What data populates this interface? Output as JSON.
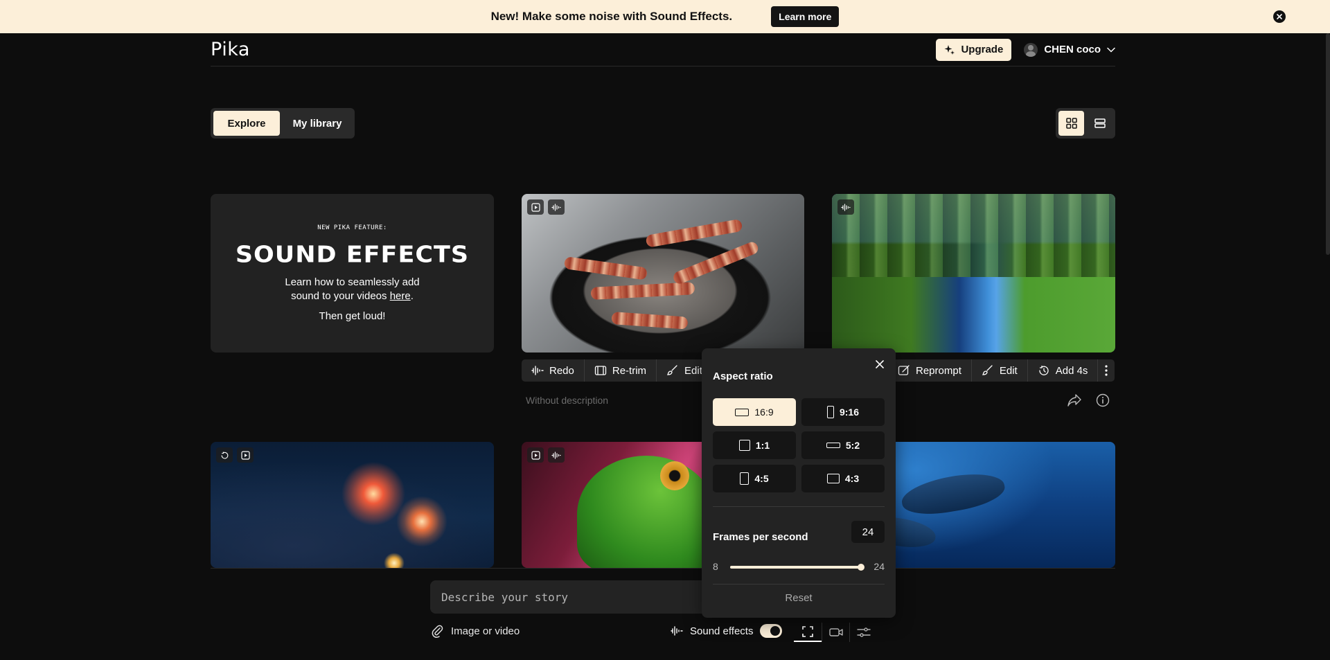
{
  "banner": {
    "text": "New! Make some noise with Sound Effects.",
    "cta": "Learn more"
  },
  "header": {
    "logo": "Pika",
    "upgrade": "Upgrade",
    "username": "CHEN coco"
  },
  "tabs": [
    {
      "label": "Explore",
      "active": true
    },
    {
      "label": "My library",
      "active": false
    }
  ],
  "promo": {
    "kicker": "NEW PIKA FEATURE:",
    "title": "SOUND EFFECTS",
    "desc_before": "Learn how to seamlessly add sound to your videos ",
    "desc_link": "here",
    "desc_after": ".",
    "cta": "Then get loud!"
  },
  "card_actions_left": {
    "redo": "Redo",
    "retrim": "Re-trim",
    "edit": "Edit"
  },
  "card_actions_right": {
    "reprompt": "Reprompt",
    "edit": "Edit",
    "add": "Add 4s"
  },
  "card_description": "Without description",
  "prompt": {
    "placeholder": "Describe your story"
  },
  "attach_label": "Image or video",
  "sound_effects_label": "Sound effects",
  "popover": {
    "title": "Aspect ratio",
    "ratios": [
      "16:9",
      "9:16",
      "1:1",
      "5:2",
      "4:5",
      "4:3"
    ],
    "selected_ratio": "16:9",
    "fps_label": "Frames per second",
    "fps_value": "24",
    "fps_min": "8",
    "fps_max": "24",
    "reset": "Reset"
  },
  "colors": {
    "accent": "#fcefd9",
    "background": "#0d0d0d",
    "panel": "#232323"
  }
}
